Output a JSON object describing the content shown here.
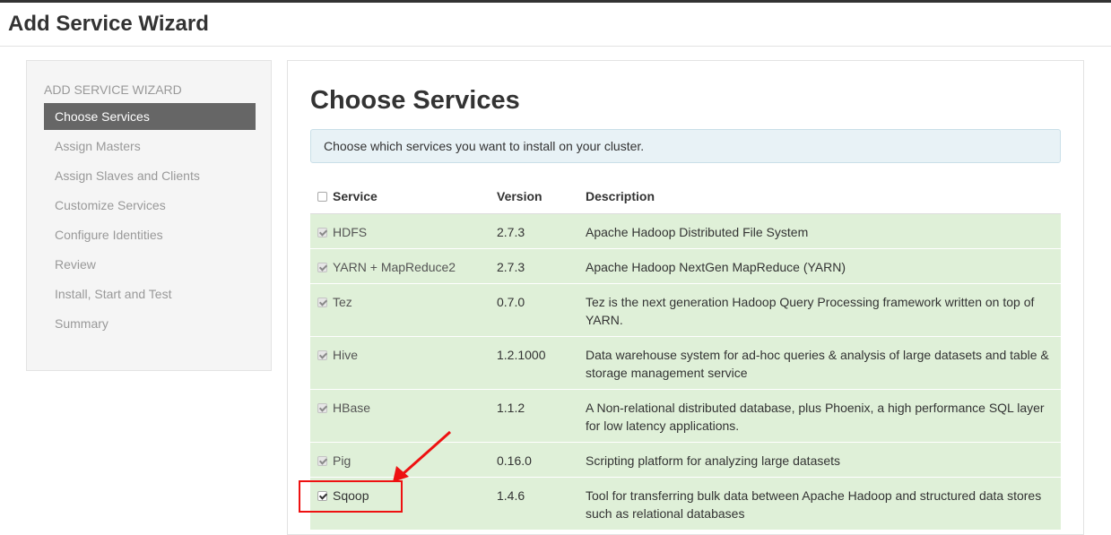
{
  "header": {
    "title": "Add Service Wizard"
  },
  "sidebar": {
    "heading": "ADD SERVICE WIZARD",
    "steps": [
      {
        "label": "Choose Services",
        "active": true
      },
      {
        "label": "Assign Masters",
        "active": false
      },
      {
        "label": "Assign Slaves and Clients",
        "active": false
      },
      {
        "label": "Customize Services",
        "active": false
      },
      {
        "label": "Configure Identities",
        "active": false
      },
      {
        "label": "Review",
        "active": false
      },
      {
        "label": "Install, Start and Test",
        "active": false
      },
      {
        "label": "Summary",
        "active": false
      }
    ]
  },
  "main": {
    "title": "Choose Services",
    "info": "Choose which services you want to install on your cluster.",
    "columns": {
      "service": "Service",
      "version": "Version",
      "description": "Description"
    },
    "rows": [
      {
        "service": "HDFS",
        "version": "2.7.3",
        "description": "Apache Hadoop Distributed File System",
        "checked": true,
        "disabled": true
      },
      {
        "service": "YARN + MapReduce2",
        "version": "2.7.3",
        "description": "Apache Hadoop NextGen MapReduce (YARN)",
        "checked": true,
        "disabled": true
      },
      {
        "service": "Tez",
        "version": "0.7.0",
        "description": "Tez is the next generation Hadoop Query Processing framework written on top of YARN.",
        "checked": true,
        "disabled": true
      },
      {
        "service": "Hive",
        "version": "1.2.1000",
        "description": "Data warehouse system for ad-hoc queries & analysis of large datasets and table & storage management service",
        "checked": true,
        "disabled": true
      },
      {
        "service": "HBase",
        "version": "1.1.2",
        "description": "A Non-relational distributed database, plus Phoenix, a high performance SQL layer for low latency applications.",
        "checked": true,
        "disabled": true
      },
      {
        "service": "Pig",
        "version": "0.16.0",
        "description": "Scripting platform for analyzing large datasets",
        "checked": true,
        "disabled": true
      },
      {
        "service": "Sqoop",
        "version": "1.4.6",
        "description": "Tool for transferring bulk data between Apache Hadoop and structured data stores such as relational databases",
        "checked": true,
        "disabled": false
      }
    ]
  },
  "colors": {
    "row_bg": "#dff0d8",
    "active_step": "#666666",
    "annotation": "#ee1111"
  }
}
